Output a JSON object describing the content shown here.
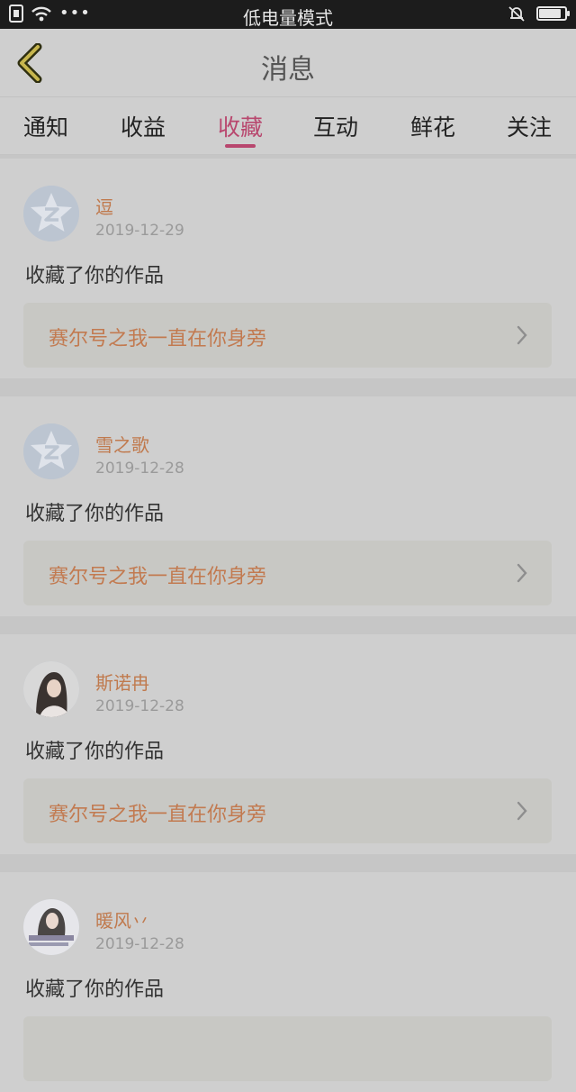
{
  "status_bar": {
    "title": "低电量模式",
    "dots": "•••",
    "battery_level": 0.85
  },
  "navbar": {
    "title": "消息",
    "back_icon": "chevron-left-icon"
  },
  "tabs": [
    {
      "label": "通知"
    },
    {
      "label": "收益"
    },
    {
      "label": "收藏",
      "active": true
    },
    {
      "label": "互动"
    },
    {
      "label": "鲜花"
    },
    {
      "label": "关注"
    }
  ],
  "items": [
    {
      "name": "逗",
      "date": "2019-12-29",
      "action": "收藏了你的作品",
      "work": "赛尔号之我一直在你身旁",
      "avatar": "default-avatar"
    },
    {
      "name": "雪之歌",
      "date": "2019-12-28",
      "action": "收藏了你的作品",
      "work": "赛尔号之我一直在你身旁",
      "avatar": "default-avatar"
    },
    {
      "name": "斯诺冉",
      "date": "2019-12-28",
      "action": "收藏了你的作品",
      "work": "赛尔号之我一直在你身旁",
      "avatar": "photo-avatar"
    },
    {
      "name": "暖风丷",
      "date": "2019-12-28",
      "action": "收藏了你的作品",
      "work": "",
      "avatar": "photo-avatar"
    }
  ],
  "colors": {
    "accent": "#b8476e",
    "name": "#c07a4e",
    "work_title": "#c27a50"
  }
}
